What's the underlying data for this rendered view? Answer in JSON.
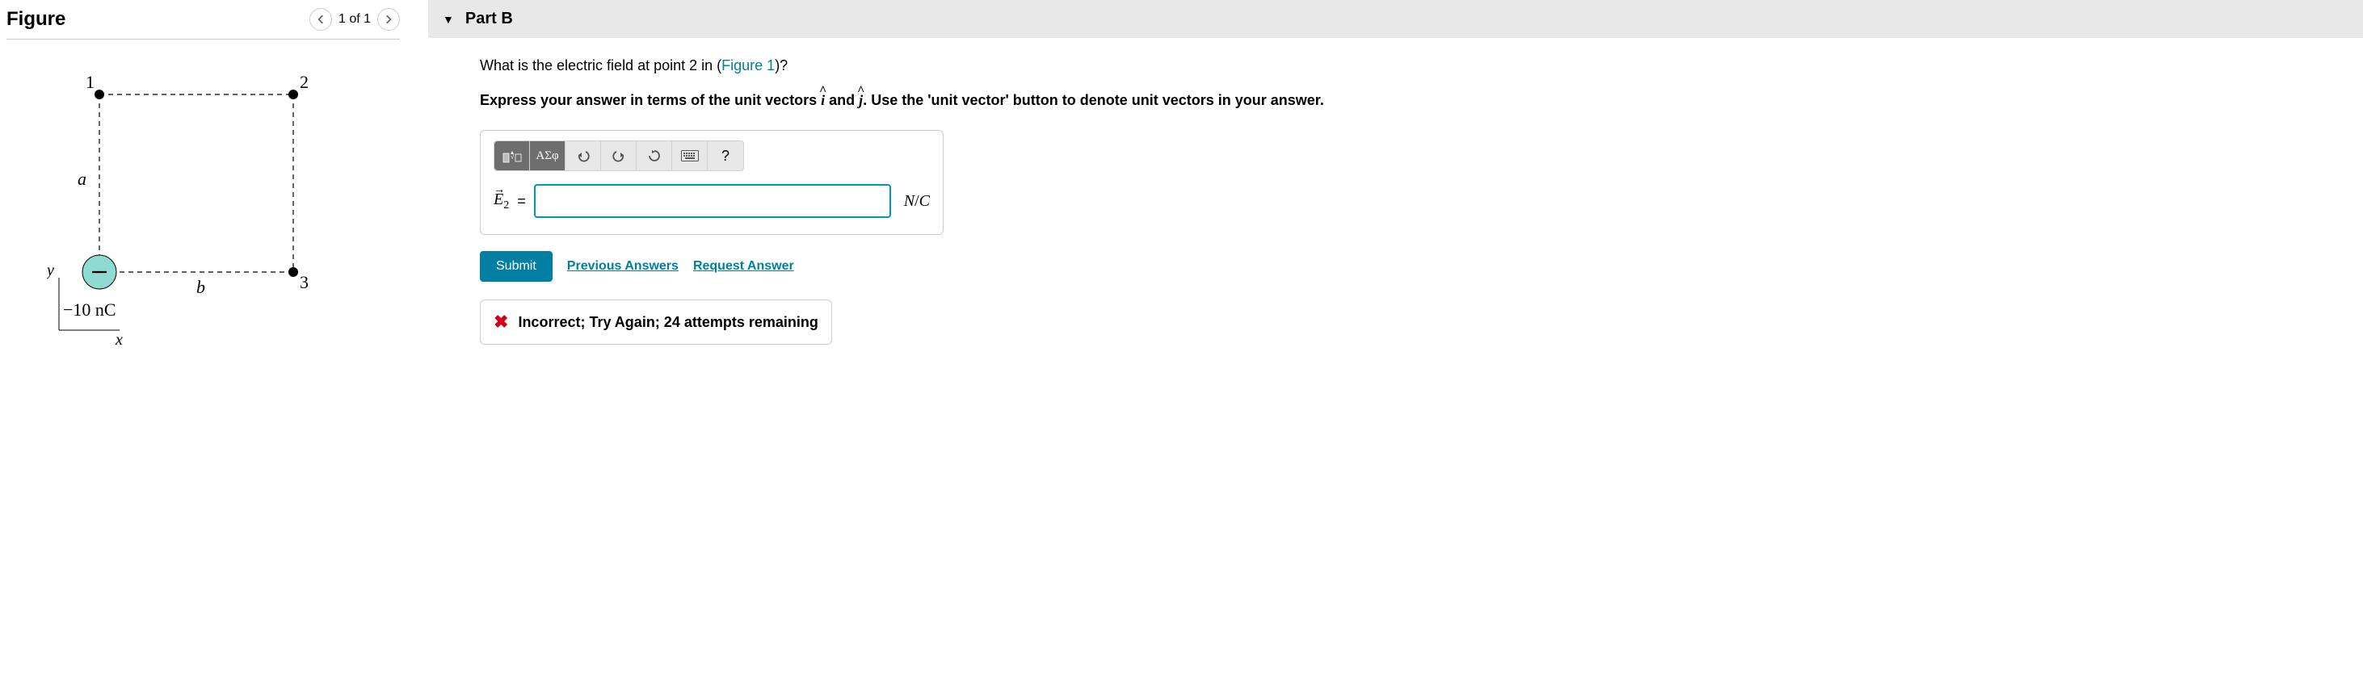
{
  "figure": {
    "title": "Figure",
    "page_indicator": "1 of 1",
    "labels": {
      "p1": "1",
      "p2": "2",
      "p3": "3",
      "a": "a",
      "b": "b",
      "x": "x",
      "y": "y"
    },
    "charge": "−10 nC"
  },
  "part": {
    "title": "Part B"
  },
  "question": {
    "prompt_pre": "What is the electric field at point 2 in (",
    "figure_link": "Figure 1",
    "prompt_post": ")?",
    "instruction_pre": "Express your answer in terms of the unit vectors ",
    "instruction_mid": " and ",
    "instruction_post": ". Use the 'unit vector' button to denote unit vectors in your answer."
  },
  "toolbar": {
    "greek": "ΑΣφ",
    "help": "?"
  },
  "input": {
    "variable": "E",
    "subscript": "2",
    "equals": "=",
    "value": "",
    "unit": "N/C"
  },
  "actions": {
    "submit": "Submit",
    "previous": "Previous Answers",
    "request": "Request Answer"
  },
  "feedback": {
    "icon": "✖",
    "text": "Incorrect; Try Again; 24 attempts remaining"
  }
}
